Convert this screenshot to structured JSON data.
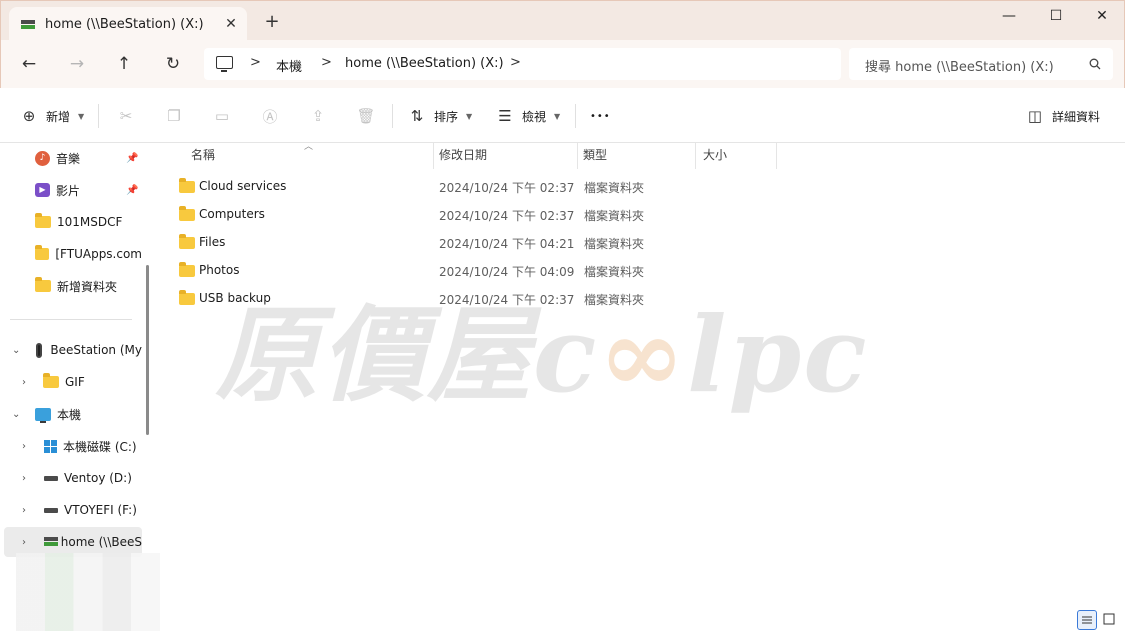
{
  "tab": {
    "title": "home (\\\\BeeStation) (X:)",
    "close_glyph": "✕",
    "new_tab_glyph": "+"
  },
  "window": {
    "minimize_glyph": "—",
    "maximize_glyph": "☐",
    "close_glyph": "✕"
  },
  "nav": {
    "back_glyph": "←",
    "forward_glyph": "→",
    "up_glyph": "↑",
    "refresh_glyph": "↻"
  },
  "address": {
    "crumbs": [
      "本機",
      "home (\\\\BeeStation) (X:)"
    ],
    "separator": ">"
  },
  "search": {
    "placeholder": "搜尋 home (\\\\BeeStation) (X:)"
  },
  "commands": {
    "new_label": "新增",
    "sort_label": "排序",
    "view_label": "檢視",
    "more_glyph": "•••",
    "details_label": "詳細資料"
  },
  "sidebar": {
    "quick_access": [
      {
        "label": "音樂",
        "icon": "music-icon",
        "pinned": true
      },
      {
        "label": "影片",
        "icon": "video-icon",
        "pinned": true
      },
      {
        "label": "101MSDCF",
        "icon": "folder-icon"
      },
      {
        "label": "[FTUApps.com",
        "icon": "folder-icon"
      },
      {
        "label": "新增資料夾",
        "icon": "folder-icon"
      }
    ],
    "tree": [
      {
        "label": "BeeStation (My",
        "icon": "nas-icon",
        "expanded": true
      },
      {
        "label": "GIF",
        "icon": "folder-icon",
        "expanded": false
      },
      {
        "label": "本機",
        "icon": "pc-icon",
        "expanded": true
      },
      {
        "label": "本機磁碟 (C:)",
        "icon": "windows-drive-icon",
        "expanded": false
      },
      {
        "label": "Ventoy (D:)",
        "icon": "drive-icon",
        "expanded": false
      },
      {
        "label": "VTOYEFI (F:)",
        "icon": "drive-icon",
        "expanded": false
      },
      {
        "label": "home (\\\\BeeS",
        "icon": "network-drive-icon",
        "expanded": false,
        "selected": true
      }
    ]
  },
  "columns": {
    "name": "名稱",
    "date": "修改日期",
    "type": "類型",
    "size": "大小"
  },
  "files": [
    {
      "name": "Cloud services",
      "date": "2024/10/24 下午 02:37",
      "type": "檔案資料夾"
    },
    {
      "name": "Computers",
      "date": "2024/10/24 下午 02:37",
      "type": "檔案資料夾"
    },
    {
      "name": "Files",
      "date": "2024/10/24 下午 04:21",
      "type": "檔案資料夾"
    },
    {
      "name": "Photos",
      "date": "2024/10/24 下午 04:09",
      "type": "檔案資料夾"
    },
    {
      "name": "USB backup",
      "date": "2024/10/24 下午 02:37",
      "type": "檔案資料夾"
    }
  ],
  "watermark": {
    "text_cjk": "原價屋",
    "text_c": "c",
    "text_inf": "∞",
    "text_lpc": "lpc"
  },
  "colors": {
    "accent": "#3b7ad8",
    "titlebar": "#f3e9e3",
    "folder": "#f8c93e"
  }
}
